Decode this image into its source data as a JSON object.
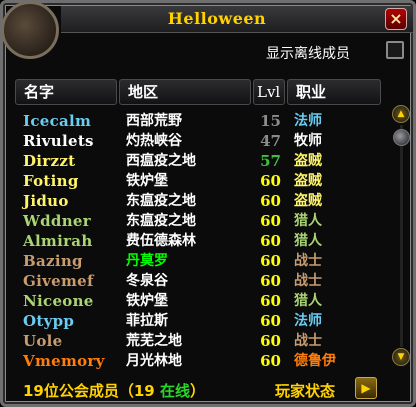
{
  "window": {
    "title": "Helloween",
    "close_label": "×"
  },
  "options": {
    "show_offline_label": "显示离线成员",
    "show_offline_checked": false
  },
  "columns": {
    "name": "名字",
    "zone": "地区",
    "level": "Lvl",
    "class": "职业"
  },
  "colors": {
    "mage": "#69ccf0",
    "priest": "#ffffff",
    "rogue": "#fff569",
    "hunter": "#abd473",
    "warrior": "#c79c6e",
    "druid": "#ff7d0a",
    "zone_default": "#ffffff",
    "zone_highlight": "#00ff00",
    "level_gray": "#8c8c8c",
    "level_green": "#40c040",
    "level_yellow": "#ffff00"
  },
  "members": [
    {
      "name": "Icecalm",
      "zone": "西部荒野",
      "level": "15",
      "class": "法师",
      "class_color": "#69ccf0",
      "zone_color": "#ffffff",
      "level_color": "#8c8c8c"
    },
    {
      "name": "Rivulets",
      "zone": "灼热峡谷",
      "level": "47",
      "class": "牧师",
      "class_color": "#ffffff",
      "zone_color": "#ffffff",
      "level_color": "#8c8c8c"
    },
    {
      "name": "Dirzzt",
      "zone": "西瘟疫之地",
      "level": "57",
      "class": "盗贼",
      "class_color": "#fff569",
      "zone_color": "#ffffff",
      "level_color": "#40c040"
    },
    {
      "name": "Foting",
      "zone": "铁炉堡",
      "level": "60",
      "class": "盗贼",
      "class_color": "#fff569",
      "zone_color": "#ffffff",
      "level_color": "#ffff00"
    },
    {
      "name": "Jiduo",
      "zone": "东瘟疫之地",
      "level": "60",
      "class": "盗贼",
      "class_color": "#fff569",
      "zone_color": "#ffffff",
      "level_color": "#ffff00"
    },
    {
      "name": "Wddner",
      "zone": "东瘟疫之地",
      "level": "60",
      "class": "猎人",
      "class_color": "#abd473",
      "zone_color": "#ffffff",
      "level_color": "#ffff00"
    },
    {
      "name": "Almirah",
      "zone": "费伍德森林",
      "level": "60",
      "class": "猎人",
      "class_color": "#abd473",
      "zone_color": "#ffffff",
      "level_color": "#ffff00"
    },
    {
      "name": "Bazing",
      "zone": "丹莫罗",
      "level": "60",
      "class": "战士",
      "class_color": "#c79c6e",
      "zone_color": "#00ff00",
      "level_color": "#ffff00"
    },
    {
      "name": "Givemef",
      "zone": "冬泉谷",
      "level": "60",
      "class": "战士",
      "class_color": "#c79c6e",
      "zone_color": "#ffffff",
      "level_color": "#ffff00"
    },
    {
      "name": "Niceone",
      "zone": "铁炉堡",
      "level": "60",
      "class": "猎人",
      "class_color": "#abd473",
      "zone_color": "#ffffff",
      "level_color": "#ffff00"
    },
    {
      "name": "Otypp",
      "zone": "菲拉斯",
      "level": "60",
      "class": "法师",
      "class_color": "#69ccf0",
      "zone_color": "#ffffff",
      "level_color": "#ffff00"
    },
    {
      "name": "Uole",
      "zone": "荒芜之地",
      "level": "60",
      "class": "战士",
      "class_color": "#c79c6e",
      "zone_color": "#ffffff",
      "level_color": "#ffff00"
    },
    {
      "name": "Vmemory",
      "zone": "月光林地",
      "level": "60",
      "class": "德鲁伊",
      "class_color": "#ff7d0a",
      "zone_color": "#ffffff",
      "level_color": "#ffff00"
    }
  ],
  "footer": {
    "count_prefix": "19位公会成员（19 ",
    "online_label": "在线",
    "count_suffix": "）",
    "player_status_label": "玩家状态",
    "player_status_button": "▶"
  },
  "scrollbar": {
    "up_label": "▲",
    "down_label": "▼"
  },
  "icons": {
    "window_icon": "scroll-icon"
  }
}
